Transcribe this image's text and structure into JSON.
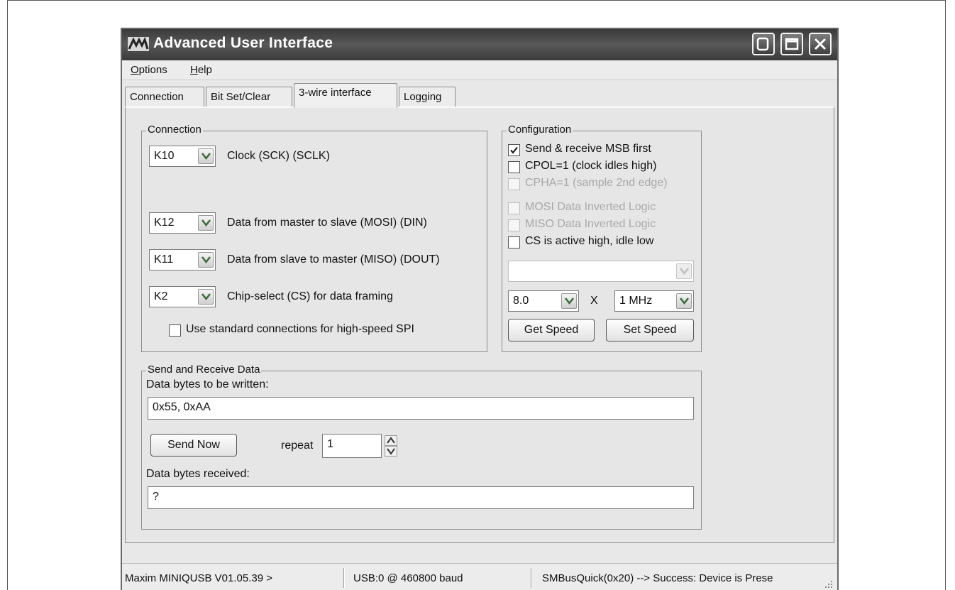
{
  "window": {
    "title": "Advanced User Interface"
  },
  "menu": [
    {
      "label_u": "O",
      "label_rest": "ptions"
    },
    {
      "label_u": "H",
      "label_rest": "elp"
    }
  ],
  "tabs": [
    {
      "label": "Connection"
    },
    {
      "label": "Bit Set/Clear"
    },
    {
      "label": "3-wire interface"
    },
    {
      "label": "Logging"
    }
  ],
  "active_tab": "3-wire interface",
  "connection": {
    "title": "Connection",
    "rows": [
      {
        "pin": "K10",
        "desc": "Clock (SCK) (SCLK)"
      },
      {
        "pin": "K12",
        "desc": "Data from master to slave (MOSI) (DIN)"
      },
      {
        "pin": "K11",
        "desc": "Data from slave to master (MISO) (DOUT)"
      },
      {
        "pin": "K2",
        "desc": "Chip-select (CS) for data framing"
      }
    ],
    "std_connections": {
      "label": "Use standard connections for high-speed SPI",
      "checked": false
    }
  },
  "configuration": {
    "title": "Configuration",
    "options": [
      {
        "label": "Send & receive MSB first",
        "checked": true,
        "enabled": true
      },
      {
        "label": "CPOL=1 (clock idles high)",
        "checked": false,
        "enabled": true
      },
      {
        "label": "CPHA=1 (sample 2nd edge)",
        "checked": false,
        "enabled": false
      },
      {
        "label": "MOSI Data Inverted Logic",
        "checked": false,
        "enabled": false
      },
      {
        "label": "MISO Data Inverted Logic",
        "checked": false,
        "enabled": false
      },
      {
        "label": "CS is active high, idle low",
        "checked": false,
        "enabled": true
      }
    ],
    "mode_value": "",
    "speed_multiplier": "8.0",
    "times": "X",
    "speed_unit": "1 MHz",
    "get_speed": "Get Speed",
    "set_speed": "Set Speed"
  },
  "send_receive": {
    "title": "Send and Receive Data",
    "write_label": "Data bytes to be written:",
    "write_value": "0x55, 0xAA",
    "send_button": "Send Now",
    "repeat_label": "repeat",
    "repeat_value": "1",
    "received_label": "Data bytes received:",
    "received_value": "?"
  },
  "status": {
    "device": "Maxim MINIQUSB V01.05.39 >",
    "port": "USB:0 @ 460800 baud",
    "message": "SMBusQuick(0x20) --> Success: Device is Prese"
  },
  "colors": {
    "titlebar": "#3a3a3a",
    "panel": "#e6e6e6",
    "disabled_text": "#a8a8a8"
  }
}
